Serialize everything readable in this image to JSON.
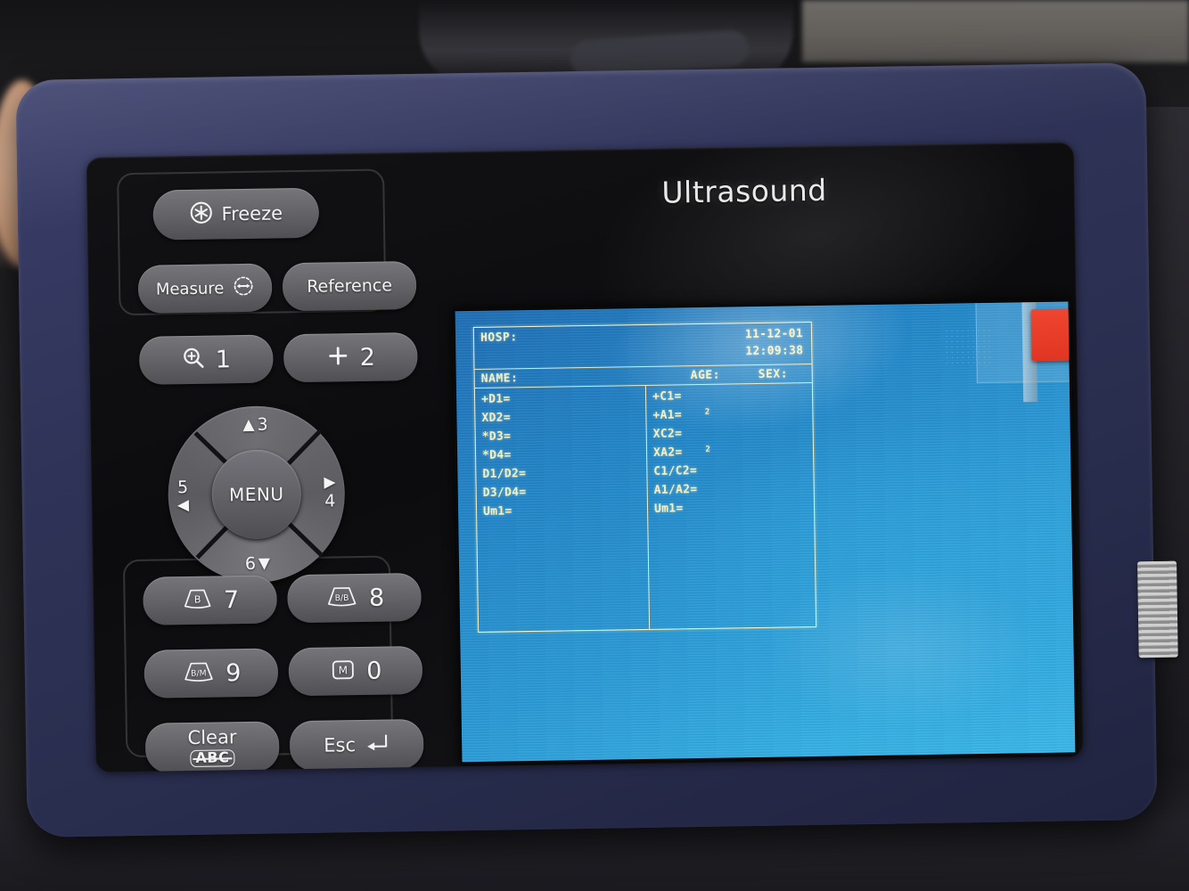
{
  "device": {
    "brand": "Ultrasound",
    "case_color": "#2f3357",
    "faceplate_color": "#121214"
  },
  "keypad": {
    "freeze": {
      "label": "Freeze",
      "icon": "snowflake-icon"
    },
    "measure": {
      "label": "Measure",
      "icon": "caliper-icon"
    },
    "reference": {
      "label": "Reference"
    },
    "zoom_key": {
      "label": "1",
      "icon": "magnifier-plus-icon"
    },
    "plus_key": {
      "label": "2",
      "icon": "plus-icon"
    },
    "b_mode": {
      "label": "7",
      "icon": "b-mode-icon",
      "icon_text": "B"
    },
    "bb_mode": {
      "label": "8",
      "icon": "bb-mode-icon",
      "icon_text": "B/B"
    },
    "bm_mode": {
      "label": "9",
      "icon": "bm-mode-icon",
      "icon_text": "B/M"
    },
    "m_mode": {
      "label": "0",
      "icon": "m-mode-icon",
      "icon_text": "M"
    },
    "clear": {
      "label": "Clear",
      "sub_label": "ABC"
    },
    "esc": {
      "label": "Esc",
      "icon": "return-arrow-icon"
    },
    "dpad": {
      "center": "MENU",
      "up": "3",
      "right": "4",
      "left": "5",
      "down": "6",
      "up_glyph": "▲",
      "right_glyph": "▶",
      "left_glyph": "◀",
      "down_glyph": "▼"
    }
  },
  "screen": {
    "background_color": "#2b9ad6",
    "text_color": "#fbf6c8",
    "header": {
      "hosp_label": "HOSP:",
      "hosp_value": "",
      "date": "11-12-01",
      "time": "12:09:38"
    },
    "patient": {
      "name_label": "NAME:",
      "name_value": "",
      "age_label": "AGE:",
      "age_value": "",
      "sex_label": "SEX:",
      "sex_value": ""
    },
    "measurements_left": [
      {
        "label": "+D1=",
        "value": ""
      },
      {
        "label": "XD2=",
        "value": ""
      },
      {
        "label": "*D3=",
        "value": ""
      },
      {
        "label": "*D4=",
        "value": ""
      },
      {
        "label": "D1/D2=",
        "value": ""
      },
      {
        "label": "D3/D4=",
        "value": ""
      },
      {
        "label": "Um1=",
        "value": ""
      }
    ],
    "measurements_right": [
      {
        "label": "+C1=",
        "value": ""
      },
      {
        "label": "+A1=",
        "value": "2",
        "superscript": true
      },
      {
        "label": "XC2=",
        "value": ""
      },
      {
        "label": "XA2=",
        "value": "2",
        "superscript": true
      },
      {
        "label": "C1/C2=",
        "value": ""
      },
      {
        "label": "A1/A2=",
        "value": ""
      },
      {
        "label": "Um1=",
        "value": ""
      }
    ],
    "protective_film": {
      "tab_color": "#e03522"
    }
  }
}
